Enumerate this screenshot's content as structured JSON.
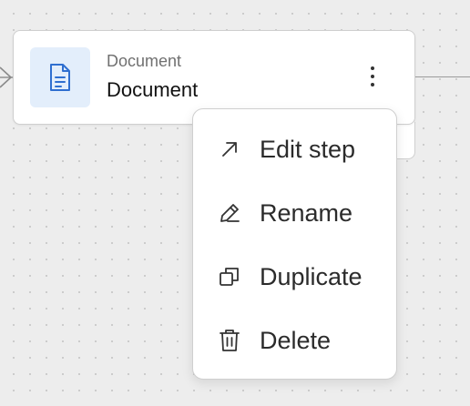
{
  "node": {
    "type_label": "Document",
    "title": "Document",
    "icon": "document-icon",
    "icon_tile_color": "#e3eefb",
    "icon_color": "#2f6fd0"
  },
  "menu": {
    "items": [
      {
        "label": "Edit step",
        "icon": "arrow-up-right-icon"
      },
      {
        "label": "Rename",
        "icon": "pencil-icon"
      },
      {
        "label": "Duplicate",
        "icon": "duplicate-icon"
      },
      {
        "label": "Delete",
        "icon": "trash-icon"
      }
    ]
  }
}
